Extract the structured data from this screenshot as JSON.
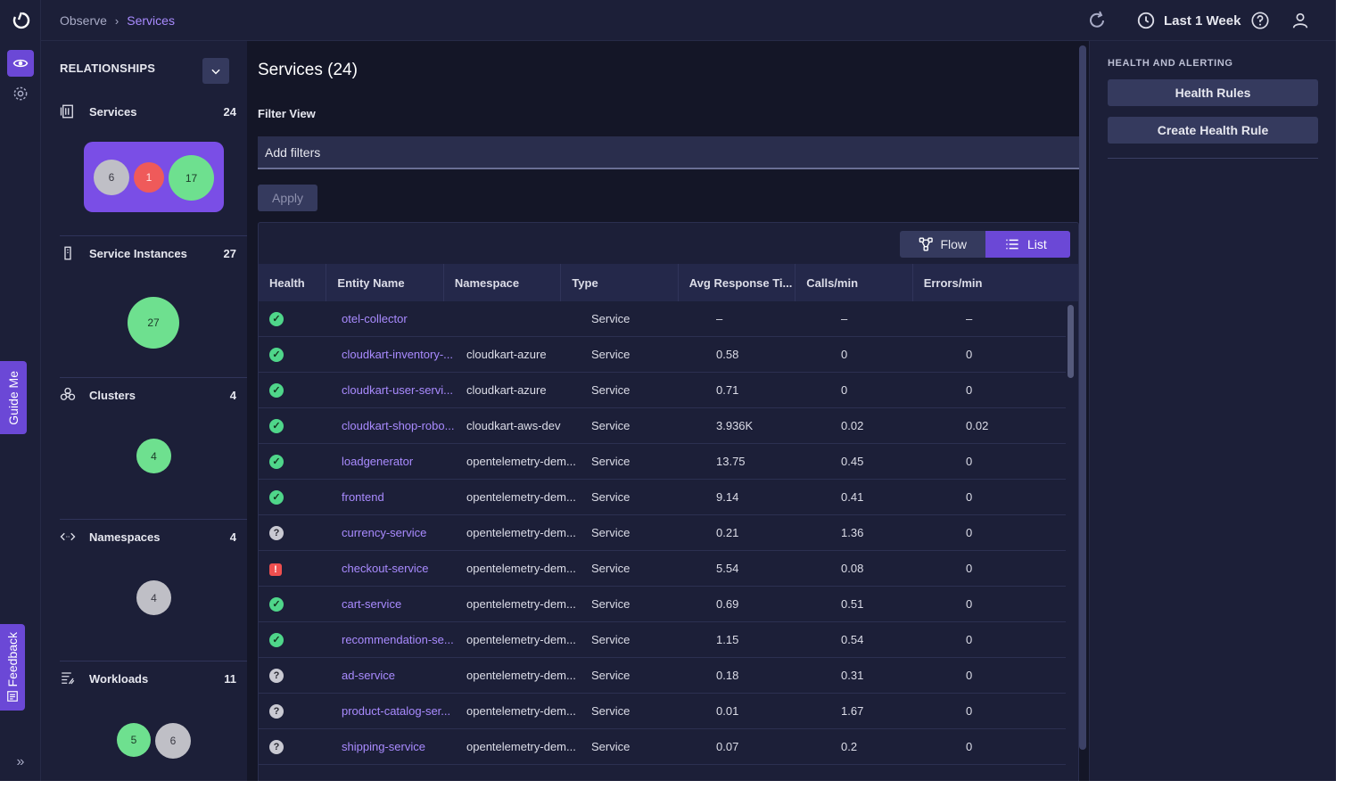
{
  "topbar": {
    "breadcrumb": [
      "Observe",
      "Services"
    ],
    "time_range": "Last 1 Week"
  },
  "side_tabs": {
    "guide": "Guide Me",
    "feedback": "Feedback"
  },
  "relationships": {
    "title": "RELATIONSHIPS",
    "sections": [
      {
        "label": "Services",
        "count": "24",
        "bubbles": [
          "6",
          "1",
          "17"
        ]
      },
      {
        "label": "Service Instances",
        "count": "27",
        "bubbles": [
          "27"
        ]
      },
      {
        "label": "Clusters",
        "count": "4",
        "bubbles": [
          "4"
        ]
      },
      {
        "label": "Namespaces",
        "count": "4",
        "bubbles": [
          "4"
        ]
      },
      {
        "label": "Workloads",
        "count": "11",
        "bubbles": [
          "5",
          "6"
        ]
      }
    ]
  },
  "main": {
    "title": "Services (24)",
    "filter_label": "Filter View",
    "filter_placeholder": "Add filters",
    "apply_label": "Apply",
    "view_toggle": {
      "flow": "Flow",
      "list": "List",
      "selected": "List"
    },
    "columns": [
      "Health",
      "Entity Name",
      "Namespace",
      "Type",
      "Avg Response Ti...",
      "Calls/min",
      "Errors/min"
    ],
    "rows": [
      {
        "health": "ok",
        "name": "otel-collector",
        "namespace": "",
        "type": "Service",
        "avg": "–",
        "calls": "–",
        "errors": "–"
      },
      {
        "health": "ok",
        "name": "cloudkart-inventory-...",
        "namespace": "cloudkart-azure",
        "type": "Service",
        "avg": "0.58",
        "calls": "0",
        "errors": "0"
      },
      {
        "health": "ok",
        "name": "cloudkart-user-servi...",
        "namespace": "cloudkart-azure",
        "type": "Service",
        "avg": "0.71",
        "calls": "0",
        "errors": "0"
      },
      {
        "health": "ok",
        "name": "cloudkart-shop-robo...",
        "namespace": "cloudkart-aws-dev",
        "type": "Service",
        "avg": "3.936K",
        "calls": "0.02",
        "errors": "0.02"
      },
      {
        "health": "ok",
        "name": "loadgenerator",
        "namespace": "opentelemetry-dem...",
        "type": "Service",
        "avg": "13.75",
        "calls": "0.45",
        "errors": "0"
      },
      {
        "health": "ok",
        "name": "frontend",
        "namespace": "opentelemetry-dem...",
        "type": "Service",
        "avg": "9.14",
        "calls": "0.41",
        "errors": "0"
      },
      {
        "health": "unknown",
        "name": "currency-service",
        "namespace": "opentelemetry-dem...",
        "type": "Service",
        "avg": "0.21",
        "calls": "1.36",
        "errors": "0"
      },
      {
        "health": "critical",
        "name": "checkout-service",
        "namespace": "opentelemetry-dem...",
        "type": "Service",
        "avg": "5.54",
        "calls": "0.08",
        "errors": "0"
      },
      {
        "health": "ok",
        "name": "cart-service",
        "namespace": "opentelemetry-dem...",
        "type": "Service",
        "avg": "0.69",
        "calls": "0.51",
        "errors": "0"
      },
      {
        "health": "ok",
        "name": "recommendation-se...",
        "namespace": "opentelemetry-dem...",
        "type": "Service",
        "avg": "1.15",
        "calls": "0.54",
        "errors": "0"
      },
      {
        "health": "unknown",
        "name": "ad-service",
        "namespace": "opentelemetry-dem...",
        "type": "Service",
        "avg": "0.18",
        "calls": "0.31",
        "errors": "0"
      },
      {
        "health": "unknown",
        "name": "product-catalog-ser...",
        "namespace": "opentelemetry-dem...",
        "type": "Service",
        "avg": "0.01",
        "calls": "1.67",
        "errors": "0"
      },
      {
        "health": "unknown",
        "name": "shipping-service",
        "namespace": "opentelemetry-dem...",
        "type": "Service",
        "avg": "0.07",
        "calls": "0.2",
        "errors": "0"
      }
    ]
  },
  "right_panel": {
    "title": "HEALTH AND ALERTING",
    "health_rules": "Health Rules",
    "create_rule": "Create Health Rule"
  },
  "colors": {
    "accent": "#6b48d6",
    "healthy": "#4fd68a",
    "critical": "#ef4f4f",
    "unknown": "#c9c9d2",
    "link": "#a98bff"
  }
}
